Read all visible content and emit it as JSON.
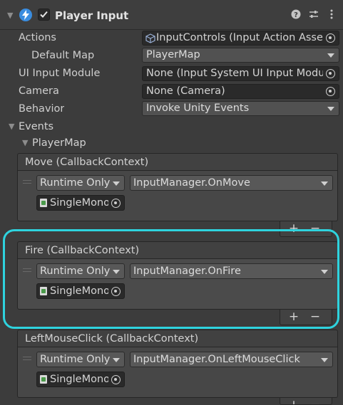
{
  "header": {
    "title": "Player Input",
    "enabled": true,
    "icons": [
      "foldout-arrow-icon",
      "input-system-icon",
      "help-icon",
      "presets-icon",
      "kebab-menu-icon"
    ]
  },
  "properties": {
    "actions": {
      "label": "Actions",
      "value": "InputControls (Input Action Asset)"
    },
    "default_map": {
      "label": "Default Map",
      "value": "PlayerMap"
    },
    "ui_input_module": {
      "label": "UI Input Module",
      "value": "None (Input System UI Input Module)"
    },
    "camera": {
      "label": "Camera",
      "value": "None (Camera)"
    },
    "behavior": {
      "label": "Behavior",
      "value": "Invoke Unity Events"
    }
  },
  "events": {
    "label": "Events",
    "map_label": "PlayerMap",
    "items": [
      {
        "title": "Move (CallbackContext)",
        "runtime": "Runtime Only",
        "function": "InputManager.OnMove",
        "object": "SingleMonoBehaviour"
      },
      {
        "title": "Fire (CallbackContext)",
        "runtime": "Runtime Only",
        "function": "InputManager.OnFire",
        "object": "SingleMonoBehaviour"
      },
      {
        "title": "LeftMouseClick (CallbackContext)",
        "runtime": "Runtime Only",
        "function": "InputManager.OnLeftMouseClick",
        "object": "SingleMonoBehaviour"
      }
    ],
    "add_label": "+",
    "remove_label": "−"
  },
  "colors": {
    "highlight": "#2ed3de",
    "component_icon": "#3a8de0"
  }
}
